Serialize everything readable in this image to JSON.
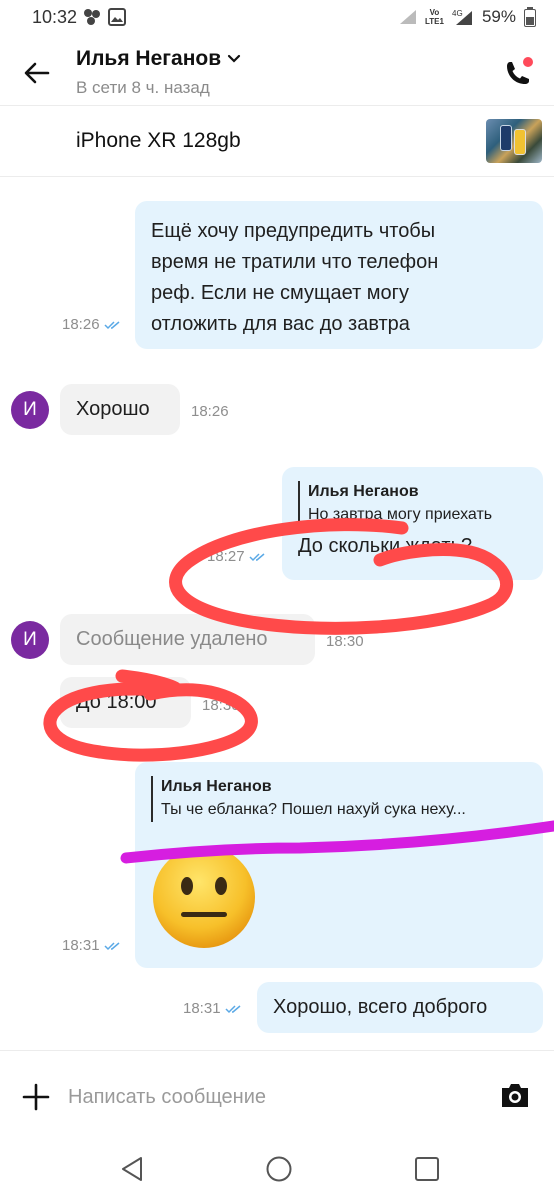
{
  "status_bar": {
    "time": "10:32",
    "network": "4G",
    "volte": "Vo\nLTE1",
    "battery": "59%"
  },
  "header": {
    "contact_name": "Илья Неганов",
    "presence": "В сети 8 ч. назад"
  },
  "item": {
    "title": "iPhone XR 128gb"
  },
  "messages": [
    {
      "dir": "out",
      "lines": [
        "Ещё хочу предупредить чтобы",
        "время не тратили что телефон",
        "реф. Если не смущает могу",
        "отложить для вас до завтра"
      ],
      "time": "18:26",
      "read": true
    },
    {
      "dir": "in",
      "avatar": "И",
      "text": "Хорошо",
      "time": "18:26"
    },
    {
      "dir": "out",
      "quote_author": "Илья Неганов",
      "quote_text": "Но завтра могу приехать",
      "text": "До скольки ждать?",
      "time": "18:27",
      "read": true
    },
    {
      "dir": "in",
      "avatar": "И",
      "text": "Сообщение удалено",
      "time": "18:30",
      "deleted": true
    },
    {
      "dir": "in",
      "text": "До 18:00",
      "time": "18:30"
    },
    {
      "dir": "out",
      "quote_author": "Илья Неганов",
      "quote_text": "Ты че ебланка? Пошел нахуй сука неху...",
      "emoji": "neutral-face",
      "time": "18:31",
      "read": true
    },
    {
      "dir": "out",
      "text": "Хорошо, всего доброго",
      "time": "18:31",
      "read": true
    }
  ],
  "composer": {
    "placeholder": "Написать сообщение"
  },
  "colors": {
    "outgoing_bubble": "#e4f3fd",
    "incoming_bubble": "#f2f2f2",
    "avatar": "#7a2aa0",
    "read_ticks": "#5aa9e6",
    "red_annotation": "#ff4a4a",
    "magenta_annotation": "#d61ee0"
  }
}
